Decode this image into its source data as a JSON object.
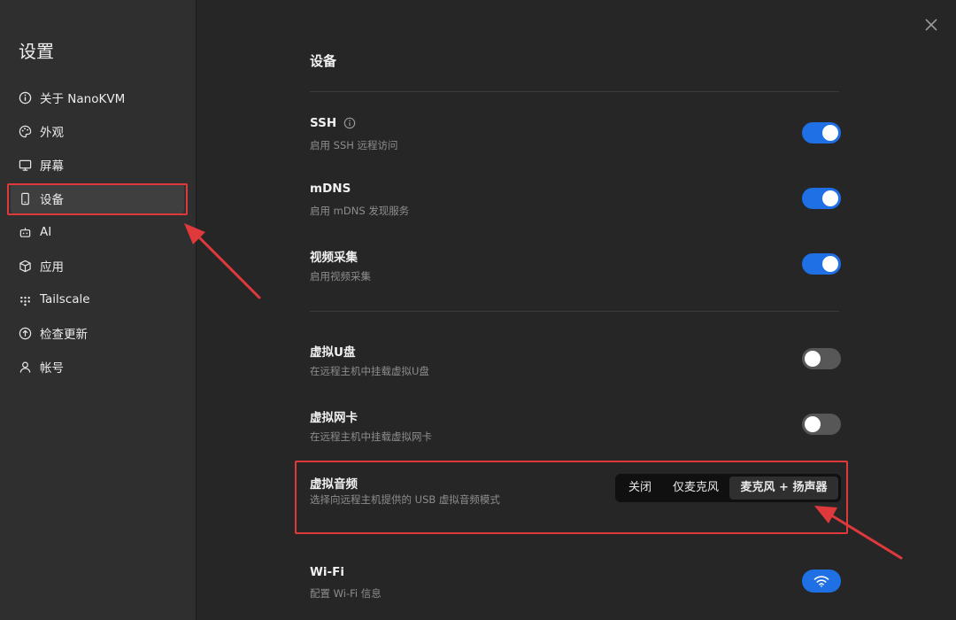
{
  "sidebar": {
    "title": "设置",
    "items": [
      {
        "label": "关于 NanoKVM",
        "icon": "info-circle-icon"
      },
      {
        "label": "外观",
        "icon": "palette-icon"
      },
      {
        "label": "屏幕",
        "icon": "monitor-icon"
      },
      {
        "label": "设备",
        "icon": "phone-device-icon",
        "active": true
      },
      {
        "label": "AI",
        "icon": "robot-icon"
      },
      {
        "label": "应用",
        "icon": "box-icon"
      },
      {
        "label": "Tailscale",
        "icon": "dots-grid-icon"
      },
      {
        "label": "检查更新",
        "icon": "arrow-up-circle-icon"
      },
      {
        "label": "帐号",
        "icon": "user-icon"
      }
    ]
  },
  "main": {
    "title": "设备",
    "settings": [
      {
        "title": "SSH",
        "desc": "启用 SSH 远程访问",
        "enabled": true,
        "has_info": true
      },
      {
        "title": "mDNS",
        "desc": "启用 mDNS 发现服务",
        "enabled": true
      },
      {
        "title": "视频采集",
        "desc": "启用视频采集",
        "enabled": true
      },
      {
        "title": "虚拟U盘",
        "desc": "在远程主机中挂载虚拟U盘",
        "enabled": false
      },
      {
        "title": "虚拟网卡",
        "desc": "在远程主机中挂载虚拟网卡",
        "enabled": false
      },
      {
        "title": "虚拟音频",
        "desc": "选择向远程主机提供的 USB 虚拟音频模式"
      },
      {
        "title": "Wi-Fi",
        "desc": "配置 Wi-Fi 信息"
      }
    ],
    "audio_modes": {
      "options": [
        "关闭",
        "仅麦克风",
        "麦克风 + 扬声器"
      ],
      "selected": "麦克风 + 扬声器"
    }
  },
  "colors": {
    "accent": "#1f6fe5",
    "highlight": "#e0393c",
    "background": "#262626",
    "sidebar": "#2f2f2f"
  }
}
